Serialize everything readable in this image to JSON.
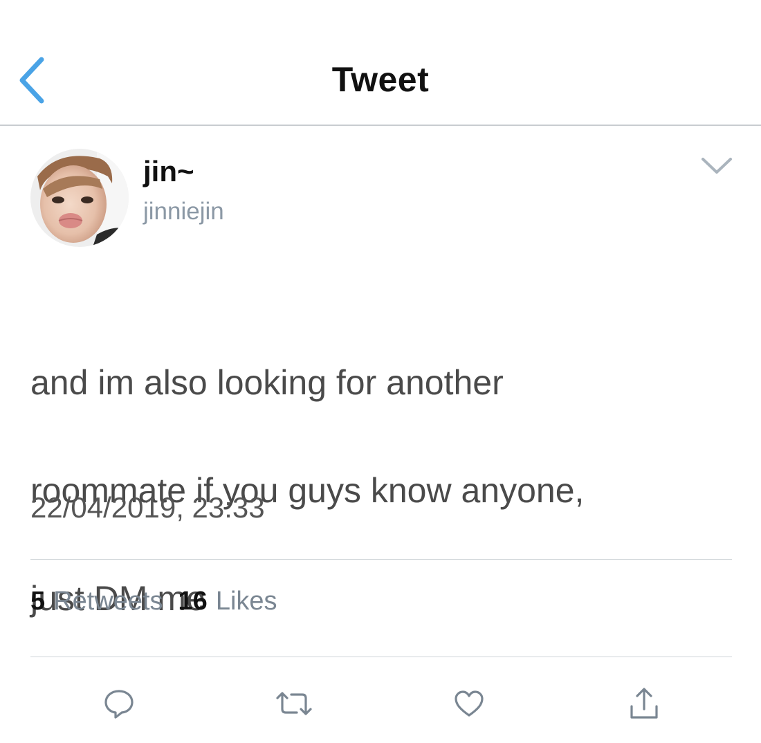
{
  "nav": {
    "title": "Tweet",
    "back_icon": "chevron-left-icon",
    "accent_color": "#4aa3e6"
  },
  "author": {
    "name": "jin~",
    "handle": "jinniejin",
    "avatar": "avatar-photo",
    "menu_icon": "chevron-down-icon"
  },
  "tweet": {
    "text_line_1": "and im also looking for another",
    "text_line_2": "roommate if you guys know anyone,",
    "text_line_3": "just DM me",
    "timestamp": "22/04/2019, 23:33"
  },
  "stats": {
    "retweets_count": "5",
    "retweets_label": "Retweets",
    "likes_count": "16",
    "likes_label": "Likes"
  },
  "actions": [
    {
      "icon": "reply-icon"
    },
    {
      "icon": "retweet-icon"
    },
    {
      "icon": "like-heart-icon"
    },
    {
      "icon": "share-icon"
    }
  ],
  "colors": {
    "text_primary": "#111111",
    "text_body": "#4a4a4a",
    "text_secondary": "#8b98a5",
    "divider": "#cfd4d8",
    "icon_gray": "#7a8692"
  }
}
